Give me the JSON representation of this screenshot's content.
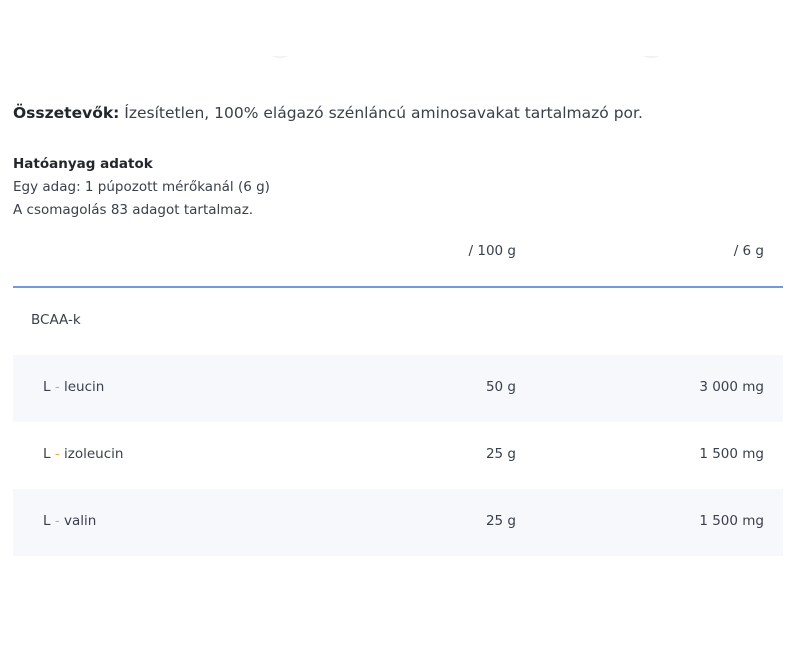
{
  "ingredients": {
    "label": "Összetevők:",
    "text": "Ízesítetlen, 100% elágazó szénláncú aminosavakat tartalmazó por."
  },
  "info": {
    "title": "Hatóanyag adatok",
    "serving": "Egy adag: 1 púpozott mérőkanál (6 g)",
    "servings_count": "A csomagolás 83 adagot tartalmaz."
  },
  "table": {
    "headers": [
      "",
      "/ 100 g",
      "/ 6 g"
    ],
    "group": "BCAA-k",
    "rows": [
      {
        "prefix": "L",
        "sep": "-",
        "name": "leucin",
        "per100": "50 g",
        "perServing": "3 000 mg"
      },
      {
        "prefix": "L",
        "sep": "-",
        "name": "izoleucin",
        "per100": "25 g",
        "perServing": "1 500 mg"
      },
      {
        "prefix": "L",
        "sep": "-",
        "name": "valin",
        "per100": "25 g",
        "perServing": "1 500 mg"
      }
    ]
  },
  "colors": {
    "header_rule": "#6f9be0",
    "row_shade": "#f6f8fc",
    "dash": "#e8a64a"
  }
}
